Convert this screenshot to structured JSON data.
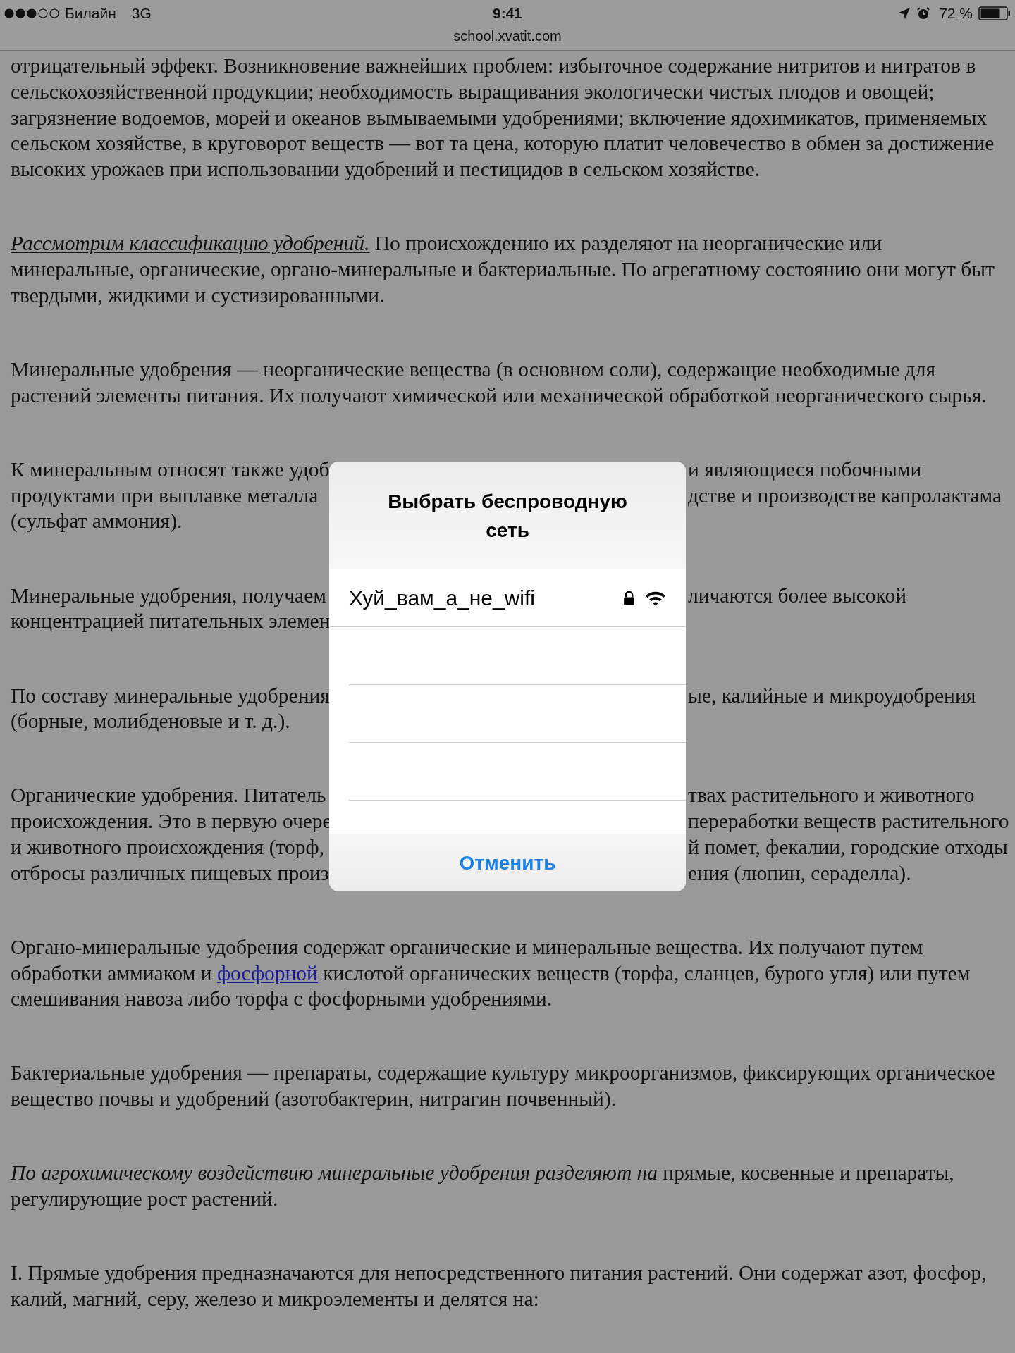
{
  "status_bar": {
    "carrier": "Билайн",
    "network": "3G",
    "time": "9:41",
    "battery": "72 %"
  },
  "address_bar": {
    "url": "school.xvatit.com"
  },
  "article": {
    "paragraphs": [
      {
        "lines": [
          {
            "text": "отрицательный эффект. Возникновение важнейших проблем: избыточное содержание нитритов и нитратов в"
          },
          {
            "text": "сельскохозяйственной продукции; необходимость выращивания экологически чистых плодов и овощей;"
          },
          {
            "text": "загрязнение водоемов, морей и океанов вымываемыми удобрениями; включение ядохимикатов, применяемых"
          },
          {
            "text": "сельском хозяйстве, в круговорот веществ — вот та цена, которую платит человечество в обмен за достижение"
          },
          {
            "text": "высоких урожаев при использовании удобрений и пестицидов в сельском хозяйстве."
          }
        ]
      },
      {
        "lines": [
          {
            "segments": [
              {
                "kind": "underlined-italic",
                "text": "Рассмотрим классификацию удобрений."
              },
              {
                "kind": "plain",
                "text": " По происхождению их разделяют на неорганические или"
              }
            ]
          },
          {
            "text": "минеральные, органические, органо-минеральные и бактериальные. По агрегатному состоянию они могут быт"
          },
          {
            "text": "твердыми, жидкими и сустизированными."
          }
        ]
      },
      {
        "lines": [
          {
            "text": "Минеральные удобрения — неорганические вещества (в основном соли), содержащие необходимые для"
          },
          {
            "text": "растений элементы питания. Их получают химической или механической обработкой неорганического сырья."
          }
        ]
      },
      {
        "lines": [
          {
            "text": "К минеральным относят также удоб",
            "right": "и являющиеся побочными"
          },
          {
            "text": "продуктами при выплавке металла",
            "right": "дстве и производстве капролактама"
          },
          {
            "text": "(сульфат аммония)."
          }
        ]
      },
      {
        "lines": [
          {
            "text": "Минеральные удобрения, получаем",
            "right": "личаются более высокой"
          },
          {
            "text": "концентрацией питательных элемен"
          }
        ]
      },
      {
        "lines": [
          {
            "text": "По составу минеральные удобрения",
            "right": "ые, калийные и микроудобрения"
          },
          {
            "text": "(борные, молибденовые и т. д.)."
          }
        ]
      },
      {
        "lines": [
          {
            "text": "Органические удобрения. Питатель",
            "right": "твах растительного и животного"
          },
          {
            "text": "происхождения. Это в первую очере",
            "right": "переработки веществ растительного"
          },
          {
            "text": "и животного происхождения (торф,",
            "right": "й помет, фекалии, городские отходы"
          },
          {
            "text": "отбросы различных пищевых произ",
            "right": "ения (люпин, сераделла)."
          }
        ]
      },
      {
        "lines": [
          {
            "text": "Органо-минеральные удобрения содержат органические и минеральные вещества. Их получают путем"
          },
          {
            "segments": [
              {
                "kind": "plain",
                "text": "обработки аммиаком и "
              },
              {
                "kind": "link",
                "text": "фосфорной"
              },
              {
                "kind": "plain",
                "text": " кислотой органических веществ (торфа, сланцев, бурого угля) или путем"
              }
            ]
          },
          {
            "text": "смешивания навоза либо торфа с фосфорными удобрениями."
          }
        ]
      },
      {
        "lines": [
          {
            "text": "Бактериальные удобрения — препараты, содержащие культуру микроорганизмов, фиксирующих органическое"
          },
          {
            "text": "вещество почвы и удобрений (азотобактерин, нитрагин почвенный)."
          }
        ]
      },
      {
        "lines": [
          {
            "segments": [
              {
                "kind": "italic",
                "text": "По агрохимическому воздействию минеральные удобрения разделяют на"
              },
              {
                "kind": "plain",
                "text": " прямые, косвенные и препараты,"
              }
            ]
          },
          {
            "text": "регулирующие рост растений."
          }
        ]
      },
      {
        "lines": [
          {
            "text": "I. Прямые удобрения предназначаются для непосредственного питания растений. Они содержат азот, фосфор,"
          },
          {
            "text": "калий, магний, серу, железо и микроэлементы и делятся на:"
          }
        ]
      }
    ]
  },
  "dialog": {
    "title": "Выбрать беспроводную сеть",
    "networks": [
      {
        "name": "Хуй_вам_а_не_wifi",
        "locked": true
      }
    ],
    "cancel": "Отменить"
  }
}
